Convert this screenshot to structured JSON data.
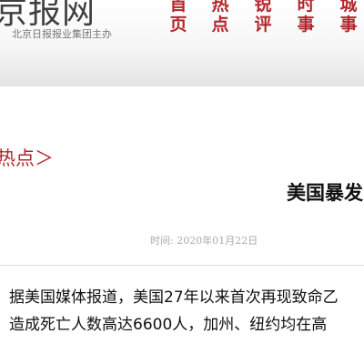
{
  "header": {
    "logo": "京报网",
    "subtitle": "北京日报报业集团主办"
  },
  "nav": [
    {
      "line1": "首",
      "line2": "页"
    },
    {
      "line1": "热",
      "line2": "点"
    },
    {
      "line1": "锐",
      "line2": "评"
    },
    {
      "line1": "时",
      "line2": "事"
    },
    {
      "line1": "城",
      "line2": "事"
    }
  ],
  "breadcrumb": "热点＞",
  "article": {
    "title": "美国暴发",
    "time": "时间: 2020年01月22日",
    "lines": [
      "据美国媒体报道，美国27年以来首次再现致命乙",
      "造成死亡人数高达6600人，加州、纽约均在高"
    ]
  },
  "colors": {
    "accent": "#b3282d",
    "text": "#111111",
    "muted": "#aaaaaa"
  }
}
